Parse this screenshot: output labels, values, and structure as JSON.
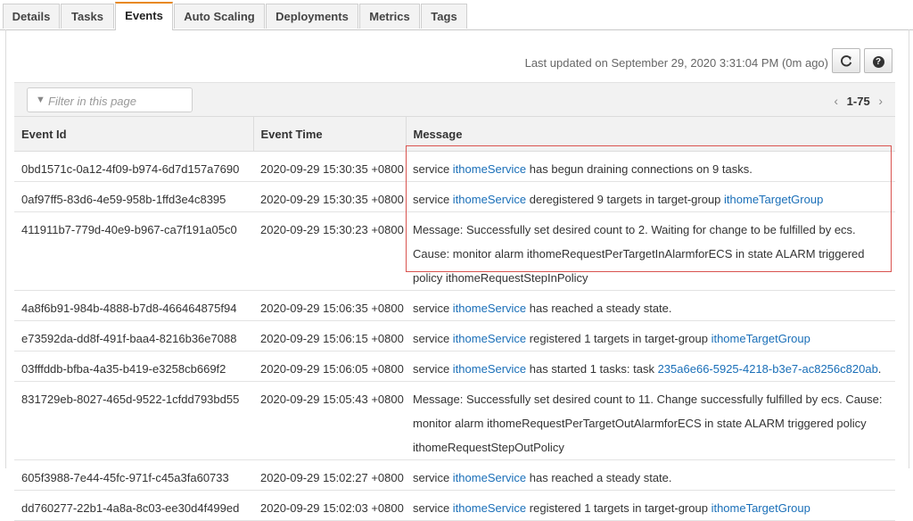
{
  "tabs": [
    "Details",
    "Tasks",
    "Events",
    "Auto Scaling",
    "Deployments",
    "Metrics",
    "Tags"
  ],
  "active_tab": "Events",
  "last_updated": "Last updated on September 29, 2020 3:31:04 PM (0m ago)",
  "buttons": {
    "refresh_icon": "refresh-icon",
    "help_icon": "help-icon",
    "help_glyph": "?"
  },
  "filter": {
    "placeholder": "Filter in this page",
    "icon": "filter-icon"
  },
  "pagination": {
    "range": "1-75",
    "prev": "‹",
    "next": "›"
  },
  "columns": [
    "Event Id",
    "Event Time",
    "Message"
  ],
  "rows": [
    {
      "id": "0bd1571c-0a12-4f09-b974-6d7d157a7690",
      "time": "2020-09-29 15:30:35 +0800",
      "message": [
        {
          "t": "service "
        },
        {
          "t": "ithomeService",
          "link": true
        },
        {
          "t": " has begun draining connections on 9 tasks."
        }
      ]
    },
    {
      "id": "0af97ff5-83d6-4e59-958b-1ffd3e4c8395",
      "time": "2020-09-29 15:30:35 +0800",
      "message": [
        {
          "t": "service "
        },
        {
          "t": "ithomeService",
          "link": true
        },
        {
          "t": " deregistered 9 targets in target-group "
        },
        {
          "t": "ithomeTargetGroup",
          "link": true
        }
      ]
    },
    {
      "id": "411911b7-779d-40e9-b967-ca7f191a05c0",
      "time": "2020-09-29 15:30:23 +0800",
      "message": [
        {
          "t": "Message: Successfully set desired count to 2. Waiting for change to be fulfilled by ecs. Cause: monitor alarm ithomeRequestPerTargetInAlarmforECS in state ALARM triggered policy ithomeRequestStepInPolicy"
        }
      ]
    },
    {
      "id": "4a8f6b91-984b-4888-b7d8-466464875f94",
      "time": "2020-09-29 15:06:35 +0800",
      "message": [
        {
          "t": "service "
        },
        {
          "t": "ithomeService",
          "link": true
        },
        {
          "t": " has reached a steady state."
        }
      ]
    },
    {
      "id": "e73592da-dd8f-491f-baa4-8216b36e7088",
      "time": "2020-09-29 15:06:15 +0800",
      "message": [
        {
          "t": "service "
        },
        {
          "t": "ithomeService",
          "link": true
        },
        {
          "t": " registered 1 targets in target-group "
        },
        {
          "t": "ithomeTargetGroup",
          "link": true
        }
      ]
    },
    {
      "id": "03fffddb-bfba-4a35-b419-e3258cb669f2",
      "time": "2020-09-29 15:06:05 +0800",
      "message": [
        {
          "t": "service "
        },
        {
          "t": "ithomeService",
          "link": true
        },
        {
          "t": " has started 1 tasks: task "
        },
        {
          "t": "235a6e66-5925-4218-b3e7-ac8256c820ab",
          "link": true
        },
        {
          "t": "."
        }
      ]
    },
    {
      "id": "831729eb-8027-465d-9522-1cfdd793bd55",
      "time": "2020-09-29 15:05:43 +0800",
      "message": [
        {
          "t": "Message: Successfully set desired count to 11. Change successfully fulfilled by ecs. Cause: monitor alarm ithomeRequestPerTargetOutAlarmforECS in state ALARM triggered policy ithomeRequestStepOutPolicy"
        }
      ]
    },
    {
      "id": "605f3988-7e44-45fc-971f-c45a3fa60733",
      "time": "2020-09-29 15:02:27 +0800",
      "message": [
        {
          "t": "service "
        },
        {
          "t": "ithomeService",
          "link": true
        },
        {
          "t": " has reached a steady state."
        }
      ]
    },
    {
      "id": "dd760277-22b1-4a8a-8c03-ee30d4f499ed",
      "time": "2020-09-29 15:02:03 +0800",
      "message": [
        {
          "t": "service "
        },
        {
          "t": "ithomeService",
          "link": true
        },
        {
          "t": " registered 1 targets in target-group "
        },
        {
          "t": "ithomeTargetGroup",
          "link": true
        }
      ]
    }
  ],
  "colors": {
    "accent_tab": "#e8891d",
    "link": "#1a6fb8",
    "highlight": "#d9534f"
  }
}
